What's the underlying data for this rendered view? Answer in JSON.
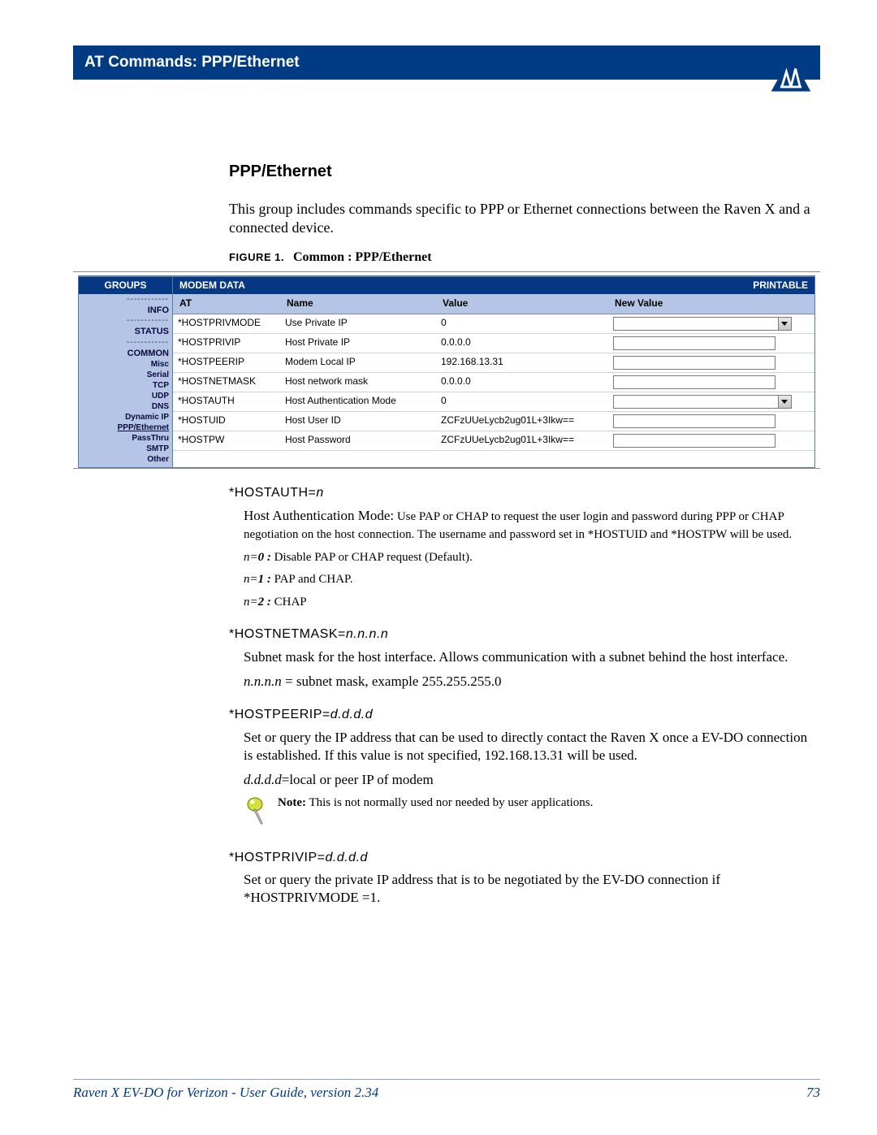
{
  "header": {
    "title": "AT Commands: PPP/Ethernet"
  },
  "section": {
    "title": "PPP/Ethernet",
    "intro": "This group includes commands specific to PPP or Ethernet connections between the Raven X and a connected device."
  },
  "figure": {
    "label": "FIGURE 1.",
    "title": "Common : PPP/Ethernet"
  },
  "embedded": {
    "groups_label": "GROUPS",
    "modem_data_label": "MODEM DATA",
    "printable_label": "PRINTABLE",
    "side_items": [
      "INFO",
      "STATUS",
      "COMMON",
      "Misc",
      "Serial",
      "TCP",
      "UDP",
      "DNS",
      "Dynamic IP",
      "PPP/Ethernet",
      "PassThru",
      "SMTP",
      "Other"
    ],
    "columns": [
      "AT",
      "Name",
      "Value",
      "New Value"
    ],
    "rows": [
      {
        "at": "*HOSTPRIVMODE",
        "name": "Use Private IP",
        "value": "0",
        "control": "select"
      },
      {
        "at": "*HOSTPRIVIP",
        "name": "Host Private IP",
        "value": "0.0.0.0",
        "control": "text"
      },
      {
        "at": "*HOSTPEERIP",
        "name": "Modem Local IP",
        "value": "192.168.13.31",
        "control": "text"
      },
      {
        "at": "*HOSTNETMASK",
        "name": "Host network mask",
        "value": "0.0.0.0",
        "control": "text"
      },
      {
        "at": "*HOSTAUTH",
        "name": "Host Authentication Mode",
        "value": "0",
        "control": "select"
      },
      {
        "at": "*HOSTUID",
        "name": "Host User ID",
        "value": "ZCFzUUeLycb2ug01L+3Ikw==",
        "control": "text"
      },
      {
        "at": "*HOSTPW",
        "name": "Host Password",
        "value": "ZCFzUUeLycb2ug01L+3Ikw==",
        "control": "text"
      }
    ]
  },
  "commands": {
    "hostauth": {
      "head": "*HOSTAUTH=",
      "param": "n",
      "lead_bold": "Host Authentication Mode:",
      "lead_rest": " Use PAP or CHAP to request the user login and password during PPP or CHAP negotiation on the host connection.  The username and password set in *HOSTUID and *HOSTPW will be used.",
      "opts": [
        {
          "k": "n=",
          "b": "0 :",
          "t": " Disable PAP or CHAP request (Default)."
        },
        {
          "k": "n=",
          "b": "1 :",
          "t": " PAP and CHAP."
        },
        {
          "k": "n=",
          "b": "2 :",
          "t": " CHAP"
        }
      ]
    },
    "hostnetmask": {
      "head": "*HOSTNETMASK=",
      "param": "n.n.n.n",
      "body1": "Subnet mask for the host interface. Allows communication with a subnet behind the host interface.",
      "body2_k": "n.n.n.n",
      "body2_t": " = subnet mask, example   255.255.255.0"
    },
    "hostpeerip": {
      "head": "*HOSTPEERIP=",
      "param": "d.d.d.d",
      "body1": "Set or query the IP address that can be used to directly contact the Raven X once a EV-DO connection is established. If this value is not specified, 192.168.13.31 will be used.",
      "body2_k": "d.d.d.d",
      "body2_t": "=local or peer IP of modem",
      "note_label": "Note:",
      "note_text": " This is not normally used nor needed by user applications."
    },
    "hostprivip": {
      "head": "*HOSTPRIVIP=",
      "param": "d.d.d.d",
      "body1": "Set or query the private IP address that is to be negotiated by the EV-DO connection if *HOSTPRIVMODE =1."
    }
  },
  "footer": {
    "left": "Raven X EV-DO for Verizon - User Guide, version 2.34",
    "page": "73"
  }
}
